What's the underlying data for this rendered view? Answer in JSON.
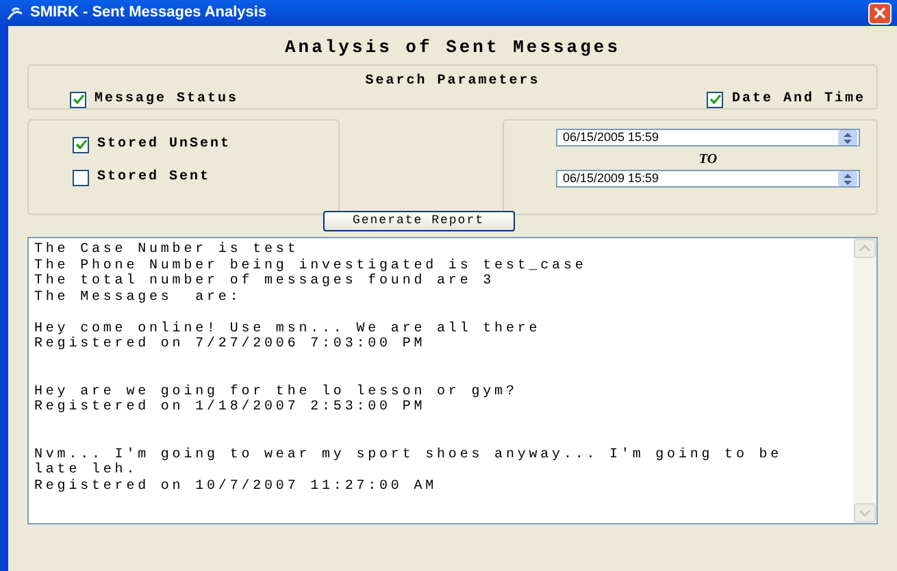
{
  "window": {
    "title": "SMIRK - Sent Messages Analysis"
  },
  "heading": "Analysis of Sent Messages",
  "search_parameters": {
    "title": "Search Parameters",
    "options": [
      {
        "label": "Message Status",
        "checked": true
      },
      {
        "label": "Date And Time",
        "checked": true
      }
    ]
  },
  "status_options": [
    {
      "label": "Stored UnSent",
      "checked": true
    },
    {
      "label": "Stored Sent",
      "checked": false
    }
  ],
  "date_range": {
    "from": "06/15/2005 15:59",
    "separator": "TO",
    "to": "06/15/2009 15:59"
  },
  "generate_button": "Generate Report",
  "report": {
    "header": [
      "The Case Number is test",
      "The Phone Number being investigated is test_case",
      "The total number of messages found are 3",
      "The Messages  are:"
    ],
    "messages": [
      {
        "lines": [
          "Hey come online! Use msn... We are all there",
          "Registered on 7/27/2006 7:03:00 PM"
        ]
      },
      {
        "lines": [
          "Hey are we going for the lo lesson or gym?",
          "Registered on 1/18/2007 2:53:00 PM"
        ]
      },
      {
        "lines": [
          "Nvm... I'm going to wear my sport shoes anyway... I'm going to be",
          "late leh.",
          "Registered on 10/7/2007 11:27:00 AM"
        ]
      }
    ]
  }
}
